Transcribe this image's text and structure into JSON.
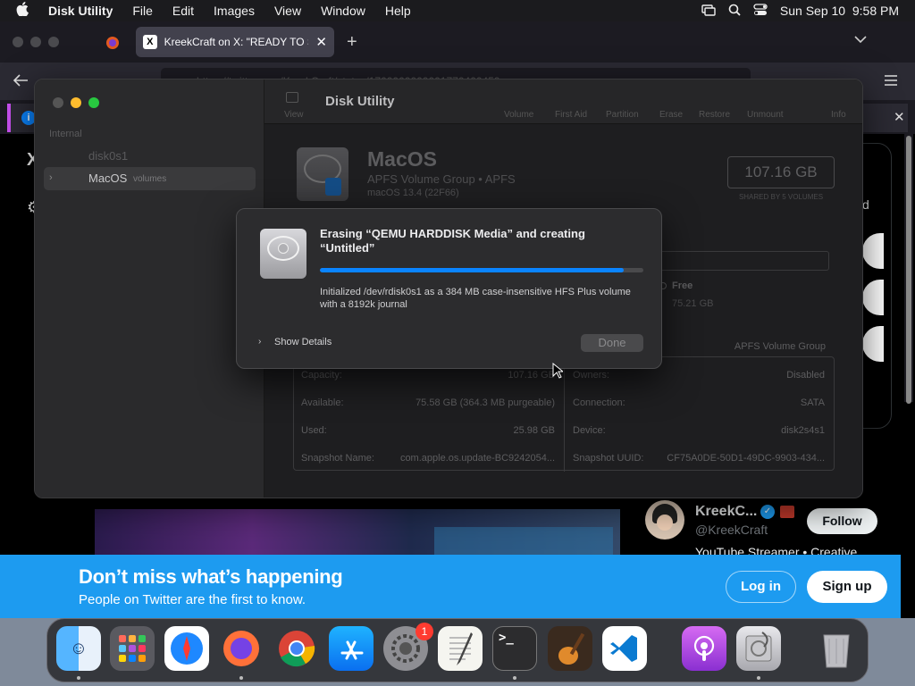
{
  "menubar": {
    "apple": "",
    "app_name": "Disk Utility",
    "items": [
      "File",
      "Edit",
      "Images",
      "View",
      "Window",
      "Help"
    ],
    "clock": "Sun Sep 10  9:58 PM"
  },
  "browser": {
    "tab_title": "KreekCraft on X: \"READY TO ST",
    "url_partial": "https://twitter.com/KreekCraft/status/1700000000001770400459"
  },
  "disk_utility": {
    "window_title": "Disk Utility",
    "sidebar": {
      "section": "Internal",
      "items": [
        {
          "label": "disk0s1",
          "sub": ""
        },
        {
          "label": "MacOS",
          "sub": "volumes"
        }
      ]
    },
    "toolbar": {
      "view": "View",
      "buttons": [
        "Volume",
        "First Aid",
        "Partition",
        "Erase",
        "Restore",
        "Unmount",
        "Info"
      ]
    },
    "volume": {
      "name": "MacOS",
      "subtitle": "APFS Volume Group • APFS",
      "os": "macOS 13.4 (22F66)",
      "size": "107.16 GB",
      "size_caption": "SHARED BY 5 VOLUMES",
      "free_label": "Free",
      "free_value": "75.21 GB"
    },
    "info": {
      "type_value": "APFS Volume Group",
      "left": [
        {
          "k": "Capacity:",
          "v": "107.16 GB"
        },
        {
          "k": "Available:",
          "v": "75.58 GB (364.3 MB purgeable)"
        },
        {
          "k": "Used:",
          "v": "25.98 GB"
        },
        {
          "k": "Snapshot Name:",
          "v": "com.apple.os.update-BC9242054..."
        }
      ],
      "right": [
        {
          "k": "Owners:",
          "v": "Disabled"
        },
        {
          "k": "Connection:",
          "v": "SATA"
        },
        {
          "k": "Device:",
          "v": "disk2s4s1"
        },
        {
          "k": "Snapshot UUID:",
          "v": "CF75A0DE-50D1-49DC-9903-434..."
        }
      ]
    }
  },
  "dialog": {
    "title": "Erasing “QEMU HARDDISK Media” and creating “Untitled”",
    "progress": 0.94,
    "message": "Initialized /dev/rdisk0s1 as a 384 MB case-insensitive HFS Plus volume with a 8192k journal",
    "show_details": "Show Details",
    "done": "Done"
  },
  "twitter": {
    "card_name": "KreekC...",
    "card_handle": "@KreekCraft",
    "card_bio": "YouTube Streamer • Creative",
    "follow": "Follow",
    "banner_title": "Don’t miss what’s happening",
    "banner_sub": "People on Twitter are the first to know.",
    "login": "Log in",
    "signup": "Sign up",
    "side_letter": "d"
  },
  "dock": {
    "badge": "1",
    "apps": [
      "finder-icon",
      "launchpad-icon",
      "safari-icon",
      "firefox-icon",
      "chrome-icon",
      "app-store-icon",
      "system-settings-icon",
      "textedit-icon",
      "terminal-icon",
      "garageband-icon",
      "vscode-icon",
      "podcasts-icon",
      "disk-utility-icon",
      "trash-icon"
    ]
  },
  "colors": {
    "accent": "#0a84ff",
    "twitter_blue": "#1d9bf0"
  }
}
